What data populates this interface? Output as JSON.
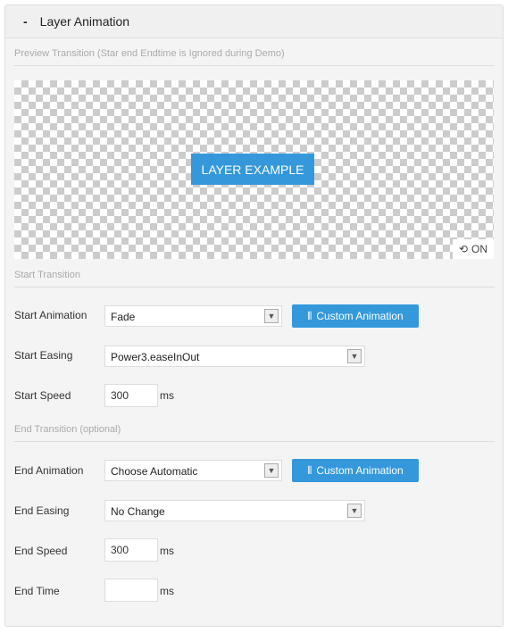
{
  "header": {
    "collapse": "-",
    "title": "Layer Animation"
  },
  "preview": {
    "section": "Preview Transition (Star end Endtime is Ignored during Demo)",
    "layer": "LAYER EXAMPLE",
    "toggle": "ON",
    "toggle_icon": "refresh-icon"
  },
  "start": {
    "section": "Start Transition",
    "animation_label": "Start Animation",
    "animation": "Fade",
    "custom_btn": "Custom Animation",
    "easing_label": "Start Easing",
    "easing": "Power3.easeInOut",
    "speed_label": "Start Speed",
    "speed": "300",
    "unit": "ms"
  },
  "end": {
    "section": "End Transition (optional)",
    "animation_label": "End Animation",
    "animation": "Choose Automatic",
    "custom_btn": "Custom Animation",
    "easing_label": "End Easing",
    "easing": "No Change",
    "speed_label": "End Speed",
    "speed": "300",
    "unit": "ms",
    "time_label": "End Time",
    "time": "",
    "time_unit": "ms"
  },
  "colors": {
    "accent": "#3498db"
  }
}
